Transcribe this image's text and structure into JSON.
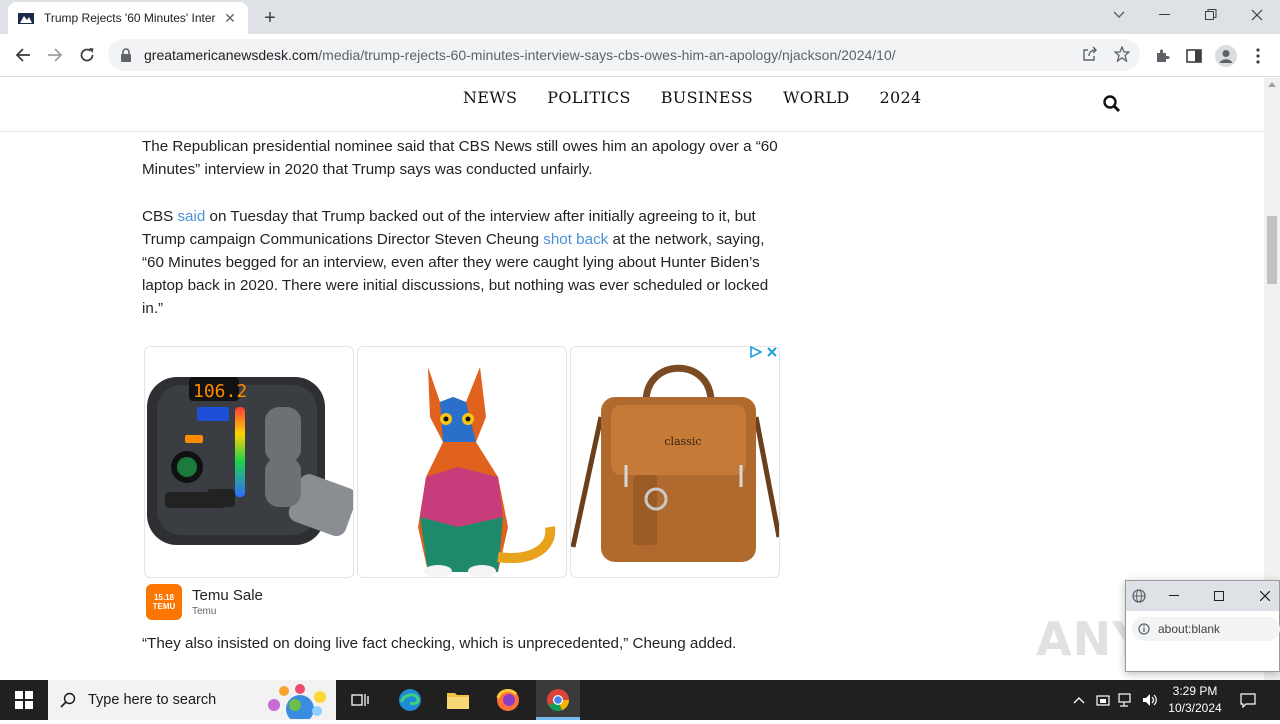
{
  "browser": {
    "tab_title": "Trump Rejects '60 Minutes' Inter",
    "url_host": "greatamericanewsdesk.com",
    "url_path": "/media/trump-rejects-60-minutes-interview-says-cbs-owes-him-an-apology/njackson/2024/10/"
  },
  "site_nav": {
    "items": [
      "NEWS",
      "POLITICS",
      "BUSINESS",
      "WORLD",
      "2024"
    ]
  },
  "article": {
    "p1": "The Republican presidential nominee said that CBS News still owes him an apology over a “60 Minutes” interview in 2020 that Trump says was conducted unfairly.",
    "p2_a": "CBS ",
    "p2_link1": "said",
    "p2_b": " on Tuesday that Trump backed out of the interview after initially agreeing to it, but Trump campaign Communications Director Steven Cheung ",
    "p2_link2": "shot back",
    "p2_c": " at the network, saying, “60 Minutes begged for an interview, even after they were caught lying about Hunter Biden’s laptop back in 2020. There were initial discussions, but nothing was ever scheduled or locked in.”",
    "p3": "“They also insisted on doing live fact checking, which is unprecedented,” Cheung added."
  },
  "ad": {
    "brand_name": "Temu Sale",
    "brand_sub": "Temu",
    "logo_line1": "15.18",
    "logo_line2": "TEMU",
    "product1_display": "106.2",
    "product3_label": "classic"
  },
  "popup": {
    "url": "about:blank"
  },
  "watermark": "ANY.RUN",
  "taskbar": {
    "search_placeholder": "Type here to search",
    "time": "3:29 PM",
    "date": "10/3/2024"
  }
}
